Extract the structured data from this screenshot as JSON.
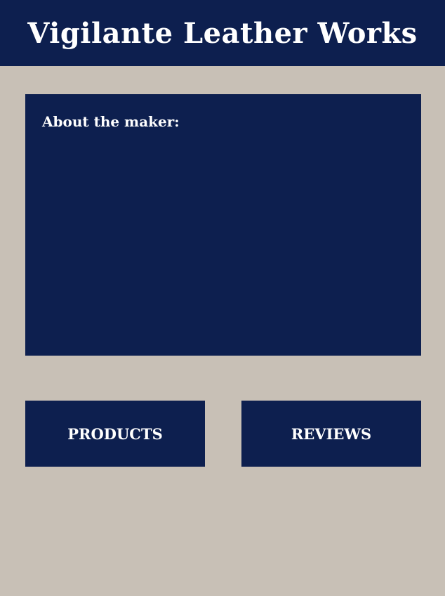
{
  "header": {
    "title": "Vigilante Leather Works"
  },
  "about": {
    "heading": "About the maker:"
  },
  "nav": {
    "products_label": "PRODUCTS",
    "reviews_label": "REVIEWS"
  },
  "colors": {
    "background": "#c8c0b6",
    "navy": "#0d1f4f",
    "text": "#ffffff"
  }
}
